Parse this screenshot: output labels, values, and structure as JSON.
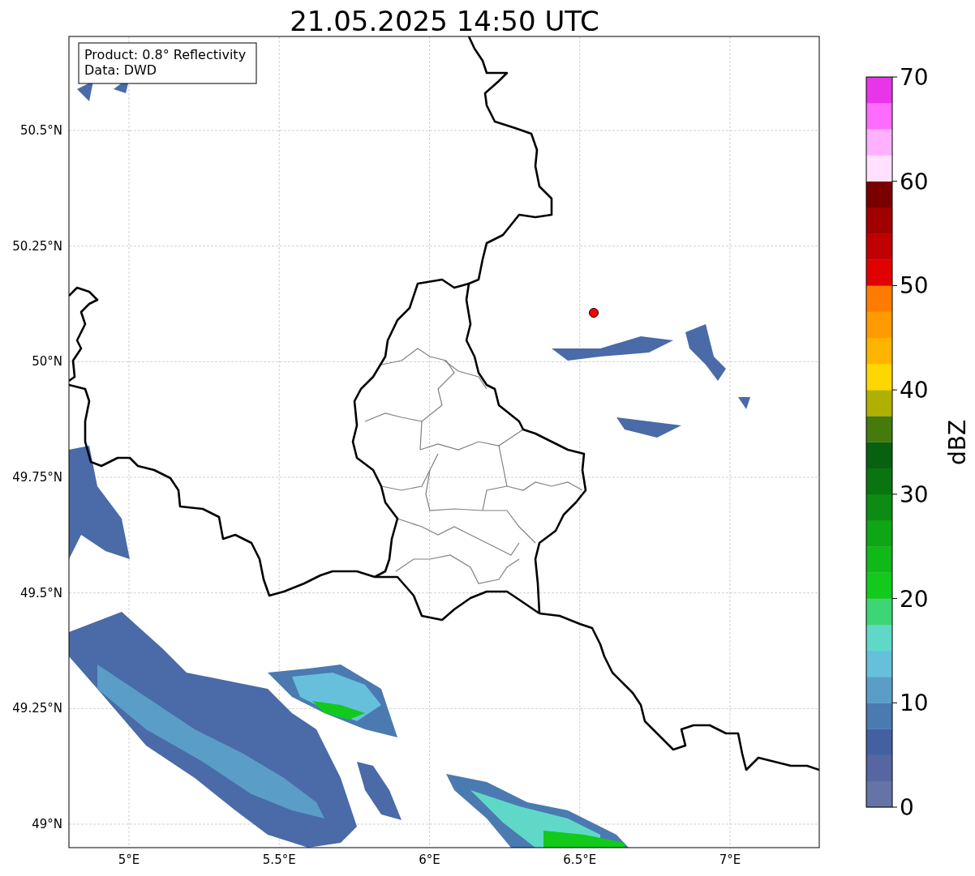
{
  "title": "21.05.2025 14:50 UTC",
  "info_box": [
    "Product: 0.8° Reflectivity",
    "Data: DWD"
  ],
  "map": {
    "xticks": [
      "5°E",
      "5.5°E",
      "6°E",
      "6.5°E",
      "7°E"
    ],
    "yticks": [
      "50.5°N",
      "50.25°N",
      "50°N",
      "49.75°N",
      "49.5°N",
      "49.25°N",
      "49°N"
    ]
  },
  "colorbar": {
    "label": "dBZ",
    "ticks": [
      "70",
      "60",
      "50",
      "40",
      "30",
      "20",
      "10",
      "0"
    ],
    "bands": [
      {
        "color": "#6574a6"
      },
      {
        "color": "#5566a0"
      },
      {
        "color": "#4360a0"
      },
      {
        "color": "#4a7ab0"
      },
      {
        "color": "#5a9ec8"
      },
      {
        "color": "#66c0dc"
      },
      {
        "color": "#60d8c8"
      },
      {
        "color": "#3dd674"
      },
      {
        "color": "#12c91c"
      },
      {
        "color": "#10b818"
      },
      {
        "color": "#0ea614"
      },
      {
        "color": "#0c8c14"
      },
      {
        "color": "#0a7412"
      },
      {
        "color": "#086010"
      },
      {
        "color": "#457a0c"
      },
      {
        "color": "#b0b000"
      },
      {
        "color": "#ffd700"
      },
      {
        "color": "#ffb400"
      },
      {
        "color": "#ff9a00"
      },
      {
        "color": "#ff7c00"
      },
      {
        "color": "#e00000"
      },
      {
        "color": "#c00000"
      },
      {
        "color": "#a00000"
      },
      {
        "color": "#7a0000"
      },
      {
        "color": "#ffe0ff"
      },
      {
        "color": "#ffb0ff"
      },
      {
        "color": "#ff6cff"
      },
      {
        "color": "#e835e8"
      }
    ]
  }
}
